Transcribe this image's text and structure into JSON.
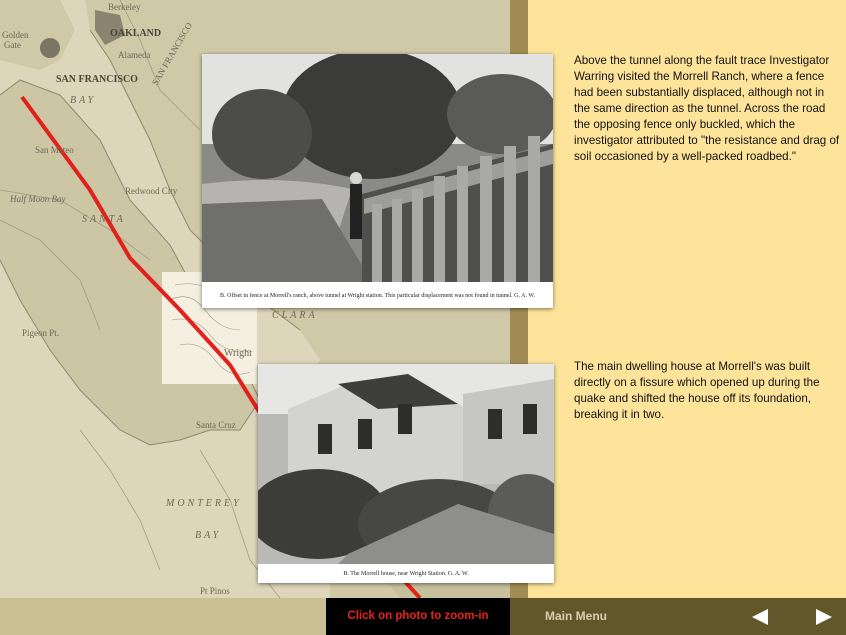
{
  "map": {
    "labels": {
      "berkeley": "Berkeley",
      "oakland": "OAKLAND",
      "golden": "Golden",
      "gate": "Gate",
      "alameda": "Alameda",
      "san_francisco": "SAN FRANCISCO",
      "bay": "BAY",
      "san_mateo": "San Mateo",
      "redwood_city": "Redwood City",
      "half_moon_bay": "Half Moon Bay",
      "santa": "SANTA",
      "pigeon_pt": "Pigeon Pt.",
      "clara": "CLARA",
      "wright": "Wright",
      "santa_cruz": "Santa Cruz",
      "monterey_bay_1": "MONTEREY",
      "monterey_bay_2": "BAY",
      "pt_pinos": "Pt Pinos",
      "monterey": "Monterey",
      "san_francisco_bay": "SAN FRANCISCO"
    },
    "colors": {
      "fault_line": "#e3211b",
      "water": "#ddd6ba",
      "land": "#ccc6a4"
    }
  },
  "photos": {
    "fence": {
      "plate_caption": "B.  Offset in fence at Morrell's ranch, above tunnel at Wright station.   This particular displacement was not found in tunnel.   G. A. W."
    },
    "house": {
      "plate_caption": "B.  The Morrell house, near Wright Station.   G. A. W."
    }
  },
  "captions": {
    "first": "Above the tunnel along the fault trace Investigator Warring visited the Morrell Ranch, where a fence had been substantially displaced, although not in the same direction as the tunnel. Across the road the opposing fence only buckled, which the investigator attributed to \"the resistance and drag of soil occasioned by a well-packed roadbed.\"",
    "second": "The main dwelling house at Morrell's was built directly on a fissure which opened up during the quake and shifted the house off its foundation, breaking it in two."
  },
  "bottom_bar": {
    "zoom_hint": "Click on photo to zoom-in",
    "main_menu": "Main Menu",
    "prev_icon": "left-arrow-icon",
    "next_icon": "right-arrow-icon",
    "colors": {
      "hint_text": "#e8231a",
      "bar": "#62572b"
    }
  }
}
